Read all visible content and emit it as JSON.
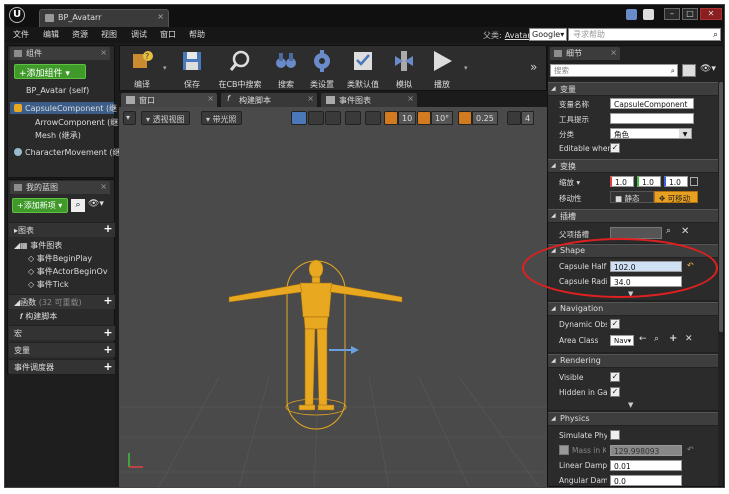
{
  "window": {
    "logo": "U",
    "tab_title": "BP_Avatarr",
    "tab_close": "×",
    "min": "–",
    "max": "□",
    "close": "✕"
  },
  "menu": {
    "items": [
      "文件",
      "编辑",
      "资源",
      "视图",
      "调试",
      "窗口",
      "帮助"
    ],
    "parent_class_label": "父类:",
    "parent_class_value": "Avatar",
    "search_engine": "Google▾",
    "help_search_placeholder": "寻求帮助"
  },
  "components": {
    "tab_label": "组件",
    "add_button": "+添加组件 ▾",
    "self": "BP_Avatar (self)",
    "items": [
      "CapsuleComponent (继",
      "ArrowComponent (继",
      "Mesh (继承)",
      "CharacterMovement (继"
    ]
  },
  "my_blueprint": {
    "tab_label": "我的蓝图",
    "add_new": "+添加新项 ▾",
    "graphs_header": "图表",
    "event_graph": "事件图表",
    "events": [
      "事件BeginPlay",
      "事件ActorBeginOv",
      "事件Tick"
    ],
    "functions_header": "函数",
    "functions_count": "(32 可重载)",
    "construction_script": "构建脚本",
    "macros_header": "宏",
    "variables_header": "变量",
    "dispatchers_header": "事件调度器"
  },
  "toolbar": {
    "buttons": [
      "编译",
      "保存",
      "在CB中搜索",
      "搜索",
      "类设置",
      "类默认值",
      "模拟",
      "播放"
    ]
  },
  "editor_tabs": [
    "窗口",
    "构建脚本",
    "事件图表"
  ],
  "viewport": {
    "perspective": "透视视图",
    "lit": "带光照",
    "grid_snap": "10",
    "rot_snap": "10°",
    "scale_snap": "0.25",
    "cam_speed": "4"
  },
  "details": {
    "tab_label": "细节",
    "search_placeholder": "搜索",
    "variable_header": "变量",
    "variable_name_label": "变量名称",
    "variable_name_value": "CapsuleComponent",
    "tooltip_label": "工具提示",
    "tooltip_value": "",
    "category_label": "分类",
    "category_value": "角色",
    "editable_label": "Editable wher",
    "transform_header": "变换",
    "scale_label": "缩放 ▾",
    "scale_values": [
      "1.0",
      "1.0",
      "1.0"
    ],
    "mobility_label": "移动性",
    "mobility_static": "静态",
    "mobility_movable": "可移动",
    "sockets_header": "插槽",
    "parent_socket_label": "父项插槽",
    "shape_header": "Shape",
    "capsule_half_label": "Capsule Half",
    "capsule_half_value": "102.0",
    "capsule_radius_label": "Capsule Radi",
    "capsule_radius_value": "34.0",
    "navigation_header": "Navigation",
    "dynamic_obs_label": "Dynamic Obs",
    "area_class_label": "Area Class",
    "area_class_value": "Nav▾",
    "rendering_header": "Rendering",
    "visible_label": "Visible",
    "hidden_label": "Hidden in Gar",
    "physics_header": "Physics",
    "simulate_label": "Simulate Phy",
    "mass_label": "Mass in K",
    "mass_value": "129.998093",
    "linear_damp_label": "Linear Dampi",
    "linear_damp_value": "0.01",
    "angular_damp_label": "Angular Damj",
    "angular_damp_value": "0.0"
  },
  "colors": {
    "accent_green": "#3f9a2a",
    "annotation_red": "#e02020",
    "mannequin": "#e8a820"
  }
}
